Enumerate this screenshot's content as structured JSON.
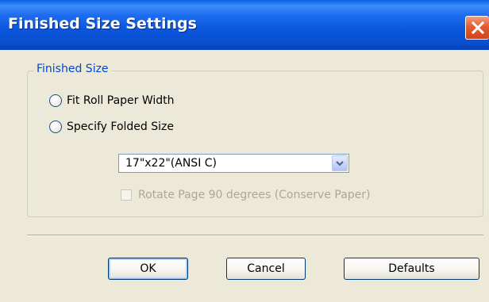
{
  "window": {
    "title": "Finished Size Settings",
    "close_icon": "close-x-icon"
  },
  "finished_size": {
    "group_label": "Finished Size",
    "option_fit_roll": "Fit Roll Paper Width",
    "option_specify_folded": "Specify Folded Size",
    "selected_option": "none",
    "folded_size_value": "17\"x22\"(ANSI C)",
    "rotate_label": "Rotate Page 90 degrees (Conserve Paper)",
    "rotate_checked": false,
    "rotate_enabled": false
  },
  "buttons": {
    "ok": "OK",
    "cancel": "Cancel",
    "defaults": "Defaults"
  },
  "colors": {
    "titlebar": "#0a56dc",
    "group_label": "#0046d5",
    "disabled_text": "#aca899"
  }
}
